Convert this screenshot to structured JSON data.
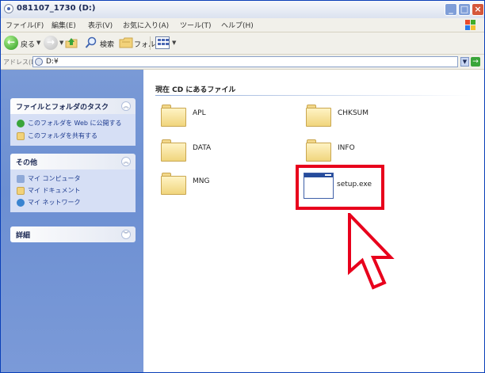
{
  "window": {
    "title": "081107_1730 (D:)"
  },
  "menubar": {
    "items": [
      "ファイル(F)",
      "編集(E)",
      "表示(V)",
      "お気に入り(A)",
      "ツール(T)",
      "ヘルプ(H)"
    ]
  },
  "toolbar": {
    "back_label": "戻る",
    "search_label": "検索",
    "folders_label": "フォルダ"
  },
  "addressbar": {
    "label": "アドレス(D)",
    "value": "D:¥",
    "go_label": "移動"
  },
  "taskpane": {
    "file_tasks": {
      "title": "ファイルとフォルダのタスク",
      "items": [
        "このフォルダを Web に公開する",
        "このフォルダを共有する"
      ]
    },
    "other_places": {
      "title": "その他",
      "items": [
        "マイ コンピュータ",
        "マイ ドキュメント",
        "マイ ネットワーク"
      ]
    },
    "details": {
      "title": "詳細"
    }
  },
  "content": {
    "group_title": "現在 CD にあるファイル",
    "folders": [
      "APL",
      "CHKSUM",
      "DATA",
      "INFO",
      "MNG"
    ],
    "exe_label": "setup.exe"
  },
  "colors": {
    "highlight": "#e8001c",
    "taskpane": "#6c8fd2",
    "title_blue": "#0a3fb8"
  }
}
